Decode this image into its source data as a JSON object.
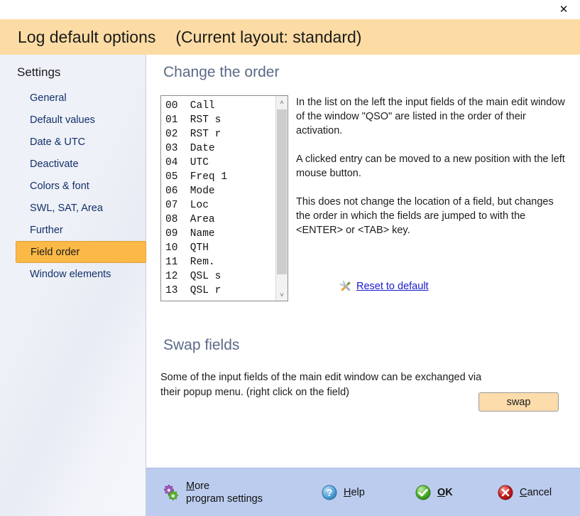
{
  "window": {
    "close_label": "✕"
  },
  "header": {
    "title": "Log default options",
    "layout_info": "(Current layout: standard)"
  },
  "sidebar": {
    "title": "Settings",
    "items": [
      {
        "label": "General",
        "selected": false
      },
      {
        "label": "Default values",
        "selected": false
      },
      {
        "label": "Date & UTC",
        "selected": false
      },
      {
        "label": "Deactivate",
        "selected": false
      },
      {
        "label": "Colors & font",
        "selected": false
      },
      {
        "label": "SWL, SAT, Area",
        "selected": false
      },
      {
        "label": "Further",
        "selected": false
      },
      {
        "label": "Field order",
        "selected": true
      },
      {
        "label": "Window elements",
        "selected": false
      }
    ]
  },
  "change_order": {
    "heading": "Change the order",
    "list": [
      {
        "index": "00",
        "name": "Call"
      },
      {
        "index": "01",
        "name": "RST s"
      },
      {
        "index": "02",
        "name": "RST r"
      },
      {
        "index": "03",
        "name": "Date"
      },
      {
        "index": "04",
        "name": "UTC"
      },
      {
        "index": "05",
        "name": "Freq 1"
      },
      {
        "index": "06",
        "name": "Mode"
      },
      {
        "index": "07",
        "name": "Loc"
      },
      {
        "index": "08",
        "name": "Area"
      },
      {
        "index": "09",
        "name": "Name"
      },
      {
        "index": "10",
        "name": "QTH"
      },
      {
        "index": "11",
        "name": "Rem."
      },
      {
        "index": "12",
        "name": "QSL s"
      },
      {
        "index": "13",
        "name": "QSL r"
      }
    ],
    "description_1": "In the list on the left the input fields of the main edit window of the window \"QSO\" are listed in the order of their activation.",
    "description_2": "A clicked entry can be moved to a new position with the left mouse button.",
    "description_3": "This does not change the location of a field, but changes the order in which the fields are jumped to with the <ENTER> or <TAB> key.",
    "reset_link": "Reset to default",
    "scroll_up": "˄",
    "scroll_down": "˅"
  },
  "swap_fields": {
    "heading": "Swap fields",
    "description": "Some of the input fields of the main edit window can be exchanged via their popup menu. (right click on the field)",
    "button_label": "swap"
  },
  "footer": {
    "more_line1_accel": "M",
    "more_line1_rest": "ore",
    "more_line2": "program settings",
    "help_accel": "H",
    "help_rest": "elp",
    "ok_accel": "O",
    "ok_rest": "K",
    "cancel_accel": "C",
    "cancel_rest": "ancel"
  },
  "colors": {
    "header_bg": "#fcdca4",
    "accent_selected": "#fcb948",
    "footer_bg": "#bcccee",
    "link": "#1a1ad0",
    "heading": "#5a6a86",
    "nav_text": "#14306b"
  }
}
